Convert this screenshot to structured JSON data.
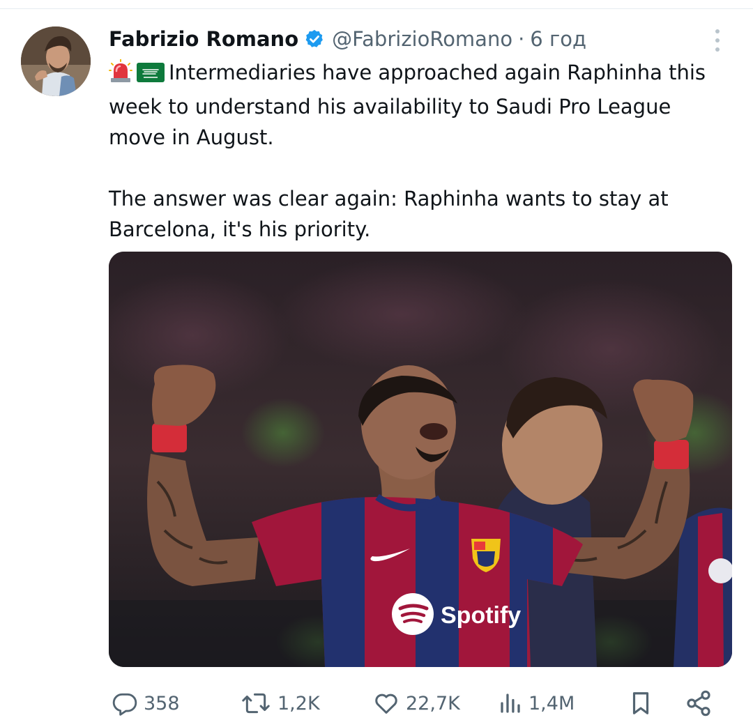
{
  "tweet": {
    "author": {
      "name": "Fabrizio Romano",
      "handle": "@FabrizioRomano",
      "separator": "·",
      "time": "6 год",
      "verified": true
    },
    "text": {
      "paragraph1": "Intermediaries have approached again Raphinha this week to understand his availability to Saudi Pro League move in August.",
      "paragraph2": "The answer was clear again: Raphinha wants to stay at Barcelona, it's his priority.",
      "emojis": [
        "police-light-emoji",
        "saudi-flag-emoji"
      ]
    },
    "media": {
      "sponsor_text": "Spotify"
    },
    "actions": {
      "replies": "358",
      "reposts": "1,2K",
      "likes": "22,7K",
      "views": "1,4M"
    },
    "colors": {
      "text": "#0f1419",
      "secondary": "#536471",
      "verified": "#1d9bf0",
      "divider": "#e6ecf0",
      "barca_blue": "#22316e",
      "barca_red": "#a1163b"
    }
  }
}
